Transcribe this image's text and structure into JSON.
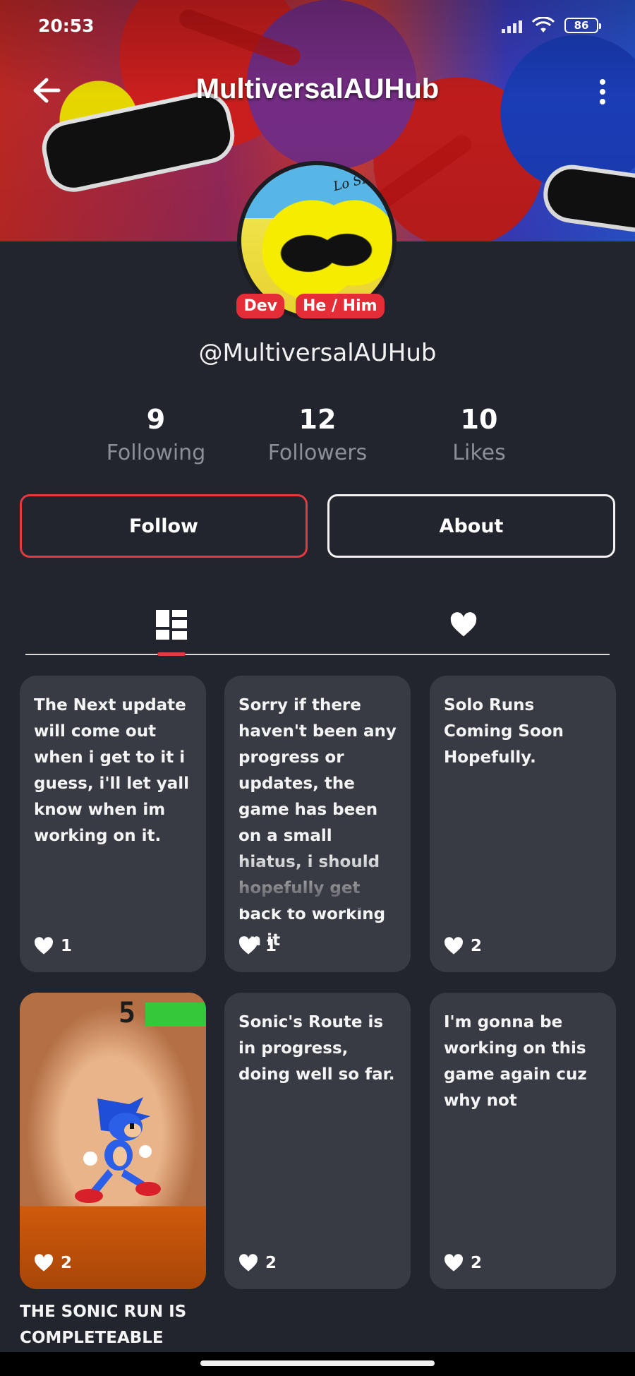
{
  "status_bar": {
    "time": "20:53",
    "battery": "86"
  },
  "header": {
    "title": "MultiversalAUHub"
  },
  "avatar": {
    "scribble_text": "Lo SP"
  },
  "profile": {
    "badges": [
      "Dev",
      "He / Him"
    ],
    "username": "@MultiversalAUHub"
  },
  "stats": [
    {
      "value": "9",
      "label": "Following"
    },
    {
      "value": "12",
      "label": "Followers"
    },
    {
      "value": "10",
      "label": "Likes"
    }
  ],
  "actions": {
    "follow_label": "Follow",
    "about_label": "About"
  },
  "tabs": [
    {
      "name": "posts",
      "icon": "grid-layout-icon",
      "active": true
    },
    {
      "name": "liked",
      "icon": "heart-icon",
      "active": false
    }
  ],
  "posts": [
    {
      "text": "The Next update will come out when i get to it i guess, i'll let yall know when im working on it.",
      "likes": "1"
    },
    {
      "text": "Sorry if there haven't been any progress or updates, the game has been on a small hiatus, i should hopefully get back to working on it",
      "likes": "1"
    },
    {
      "text": "Solo Runs Coming Soon Hopefully.",
      "likes": "2"
    },
    {
      "image": "sonic-running-pixel-art",
      "score": "5",
      "likes": "2",
      "caption": "THE SONIC RUN IS COMPLETEABLE"
    },
    {
      "text": "Sonic's Route is in progress, doing well so far.",
      "likes": "2"
    },
    {
      "text": "I'm gonna be working on this game again cuz why not",
      "likes": "2"
    }
  ],
  "colors": {
    "background": "#22252d",
    "card": "#383b43",
    "accent": "#e33a40",
    "badge": "#e52d38",
    "muted": "#8c8f96"
  }
}
